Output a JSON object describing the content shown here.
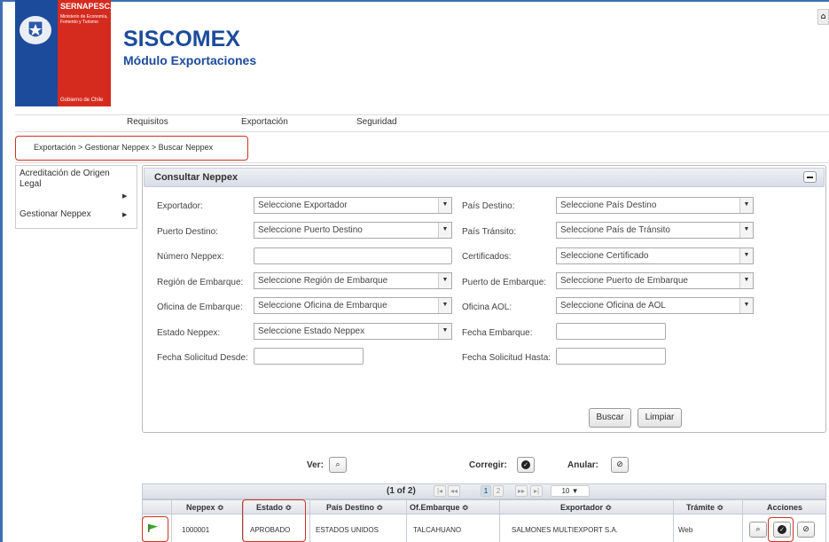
{
  "header": {
    "org": "SERNAPESCA",
    "ministry": "Ministerio de Economía, Fomento y Turismo",
    "government": "Gobierno de Chile",
    "app_title": "SISCOMEX",
    "app_subtitle": "Módulo Exportaciones"
  },
  "nav": {
    "items": [
      "Requisitos",
      "Exportación",
      "Seguridad"
    ]
  },
  "breadcrumb": "Exportación > Gestionar Neppex > Buscar Neppex",
  "sidebar": {
    "items": [
      "Acreditación de Origen Legal",
      "Gestionar Neppex"
    ]
  },
  "form": {
    "title": "Consultar Neppex",
    "exportador_label": "Exportador:",
    "exportador_value": "Seleccione Exportador",
    "pais_destino_label": "País Destino:",
    "pais_destino_value": "Seleccione País Destino",
    "puerto_destino_label": "Puerto Destino:",
    "puerto_destino_value": "Seleccione Puerto Destino",
    "pais_transito_label": "País Tránsito:",
    "pais_transito_value": "Seleccione País de Tránsito",
    "numero_neppex_label": "Número Neppex:",
    "certificados_label": "Certificados:",
    "certificados_value": "Seleccione Certificado",
    "region_label": "Región de Embarque:",
    "region_value": "Seleccione Región de Embarque",
    "puerto_embarque_label": "Puerto de Embarque:",
    "puerto_embarque_value": "Seleccione Puerto de Embarque",
    "oficina_label": "Oficina de Embarque:",
    "oficina_value": "Seleccione Oficina de Embarque",
    "oficina_aol_label": "Oficina AOL:",
    "oficina_aol_value": "Seleccione Oficina de AOL",
    "estado_label": "Estado Neppex:",
    "estado_value": "Seleccione Estado Neppex",
    "fecha_embarque_label": "Fecha Embarque:",
    "fecha_desde_label": "Fecha Solicitud Desde:",
    "fecha_hasta_label": "Fecha Solicitud Hasta:",
    "buscar": "Buscar",
    "limpiar": "Limpiar"
  },
  "legend": {
    "ver": "Ver:",
    "corregir": "Corregir:",
    "anular": "Anular:"
  },
  "table": {
    "page_info": "(1 of 2)",
    "pages": [
      "1",
      "2"
    ],
    "rows_per_page": "10",
    "columns": [
      "Neppex ≎",
      "Estado ≎",
      "País Destino ≎",
      "Of.Embarque ≎",
      "Exportador ≎",
      "Trámite ≎",
      "Acciones"
    ],
    "rows": [
      {
        "neppex": "1000001",
        "estado": "APROBADO",
        "pais": "ESTADOS UNIDOS",
        "oficina": "TALCAHUANO",
        "exportador": "SALMONES MULTIEXPORT S.A.",
        "tramite": "Web"
      }
    ]
  }
}
